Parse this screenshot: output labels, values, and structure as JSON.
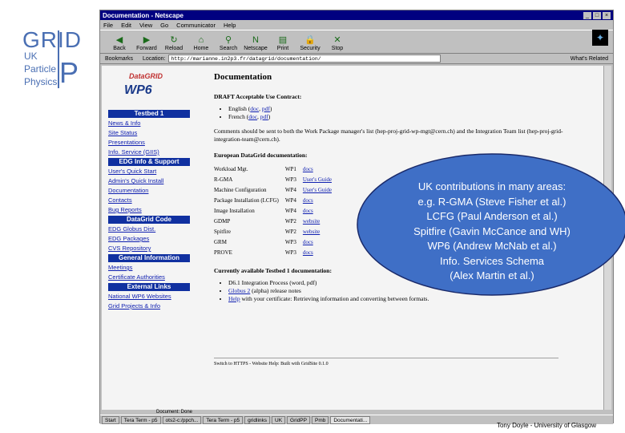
{
  "slide": {
    "logo": {
      "grid": "GRID",
      "uk": "UK",
      "particle": "Particle",
      "physics": "Physics",
      "p": "P"
    },
    "credit": "Tony Doyle - University of Glasgow",
    "callout_lines": [
      "UK contributions in many areas:",
      "e.g. R-GMA (Steve Fisher et al.)",
      "LCFG (Paul Anderson et al.)",
      "Spitfire (Gavin McCance and WH)",
      "WP6 (Andrew McNab et al.)",
      "Info. Services Schema",
      "(Alex Martin et al.)"
    ],
    "callout_color": "#3f6fc6"
  },
  "browser": {
    "title": "Documentation - Netscape",
    "menu": [
      "File",
      "Edit",
      "View",
      "Go",
      "Communicator",
      "Help"
    ],
    "toolbar": [
      {
        "label": "Back",
        "icon": "back-arrow-icon",
        "glyph": "◀"
      },
      {
        "label": "Forward",
        "icon": "forward-arrow-icon",
        "glyph": "▶"
      },
      {
        "label": "Reload",
        "icon": "reload-icon",
        "glyph": "↻"
      },
      {
        "label": "Home",
        "icon": "home-icon",
        "glyph": "⌂"
      },
      {
        "label": "Search",
        "icon": "search-icon",
        "glyph": "⚲"
      },
      {
        "label": "Netscape",
        "icon": "netscape-icon",
        "glyph": "N"
      },
      {
        "label": "Print",
        "icon": "print-icon",
        "glyph": "▤"
      },
      {
        "label": "Security",
        "icon": "security-icon",
        "glyph": "🔒"
      },
      {
        "label": "Stop",
        "icon": "stop-icon",
        "glyph": "✕"
      }
    ],
    "bookmarks_label": "Bookmarks",
    "location_label": "Location:",
    "location_value": "http://marianne.in2p3.fr/datagrid/documentation/",
    "whats_related": "What's Related",
    "status": "Document: Done"
  },
  "nav": {
    "logo_grid": "DataGRID",
    "logo_wp": "WP6",
    "sections": [
      {
        "header": "Testbed 1",
        "links": [
          "News & Info",
          "Site Status",
          "Presentations",
          "Info. Service (GIIS)"
        ]
      },
      {
        "header": "EDG Info & Support",
        "links": [
          "User's Quick Start",
          "Admin's Quick Install",
          "Documentation",
          "Contacts",
          "Bug Reports"
        ]
      },
      {
        "header": "DataGrid Code",
        "links": [
          "EDG Globus Dist.",
          "EDG Packages",
          "CVS Repository"
        ]
      },
      {
        "header": "General Information",
        "links": [
          "Meetings",
          "Certificate Authorities"
        ]
      },
      {
        "header": "External Links",
        "links": [
          "National WP6 Websites",
          "Grid Projects & Info"
        ]
      }
    ]
  },
  "content": {
    "heading": "Documentation",
    "draft_title": "DRAFT Acceptable Use Contract:",
    "draft_items": [
      {
        "lang": "English (",
        "doc": "doc",
        "sep": ", ",
        "pdf": "pdf",
        "end": ")"
      },
      {
        "lang": "French (",
        "doc": "doc",
        "sep": ", ",
        "pdf": "pdf",
        "end": ")"
      }
    ],
    "comments": "Comments should be sent to both the Work Package manager's list (hep-proj-grid-wp-mgt@cern.ch) and the Integration Team list (hep-proj-grid-integration-team@cern.ch).",
    "euro_title": "European DataGrid documentation:",
    "doc_rows": [
      [
        "Workload Mgt.",
        "WP1",
        "docs"
      ],
      [
        "R-GMA",
        "WP3",
        "User's Guide"
      ],
      [
        "Machine Configuration",
        "WP4",
        "User's Guide"
      ],
      [
        "Package Installation (LCFG)",
        "WP4",
        "docs"
      ],
      [
        "Image Installation",
        "WP4",
        "docs"
      ],
      [
        "GDMP",
        "WP2",
        "website"
      ],
      [
        "Spitfire",
        "WP2",
        "website"
      ],
      [
        "GRM",
        "WP3",
        "docs"
      ],
      [
        "PROVE",
        "WP3",
        "docs"
      ]
    ],
    "current_title": "Currently available Testbed 1 documentation:",
    "current_items": [
      {
        "link": "",
        "text": "D6.1 Integration Process (word, pdf)"
      },
      {
        "link": "Globus 2",
        "text": " (alpha) release notes"
      },
      {
        "link": "Help",
        "text": " with your certificate: Retrieving information and converting between formats."
      }
    ],
    "footer": "Switch to HTTPS - Website Help: Built with GridSite 0.1.0"
  },
  "taskbar": {
    "start": "Start",
    "tasks": [
      "Tera Term - p5",
      "ots2-c:/ppch...",
      "Tera Term - p5",
      "gridlinks",
      "UK",
      "GridPP",
      "Pmb",
      "Documentati..."
    ],
    "active_index": 7
  }
}
